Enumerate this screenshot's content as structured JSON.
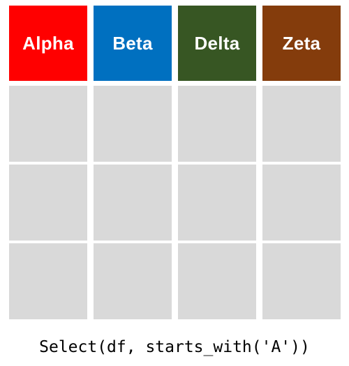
{
  "columns": [
    {
      "label": "Alpha",
      "color": "#ff0000"
    },
    {
      "label": "Beta",
      "color": "#0070c0"
    },
    {
      "label": "Delta",
      "color": "#375623"
    },
    {
      "label": "Zeta",
      "color": "#843c0c"
    }
  ],
  "cell_color": "#d9d9d9",
  "caption": "Select(df, starts_with('A'))"
}
